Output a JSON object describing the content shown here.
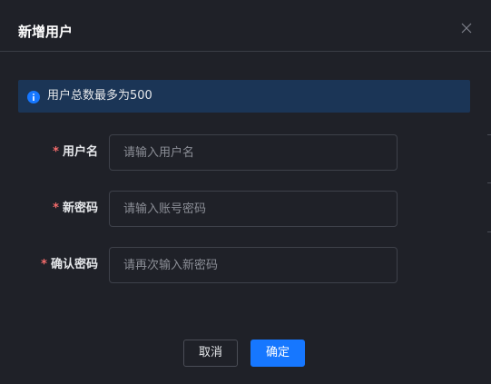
{
  "dialog": {
    "title": "新增用户",
    "close_icon": "close-icon"
  },
  "alert": {
    "icon": "info-icon",
    "text": "用户总数最多为500",
    "color": "#1b3556"
  },
  "form": {
    "username": {
      "label": "用户名",
      "required_mark": "*",
      "placeholder": "请输入用户名",
      "value": ""
    },
    "new_password": {
      "label": "新密码",
      "required_mark": "*",
      "placeholder": "请输入账号密码",
      "value": ""
    },
    "confirm_password": {
      "label": "确认密码",
      "required_mark": "*",
      "placeholder": "请再次输入新密码",
      "value": ""
    }
  },
  "footer": {
    "cancel_label": "取消",
    "confirm_label": "确定"
  },
  "colors": {
    "background": "#1f2128",
    "primary": "#1677ff",
    "required": "#f56c6c",
    "alert_bg": "#1b3556"
  }
}
